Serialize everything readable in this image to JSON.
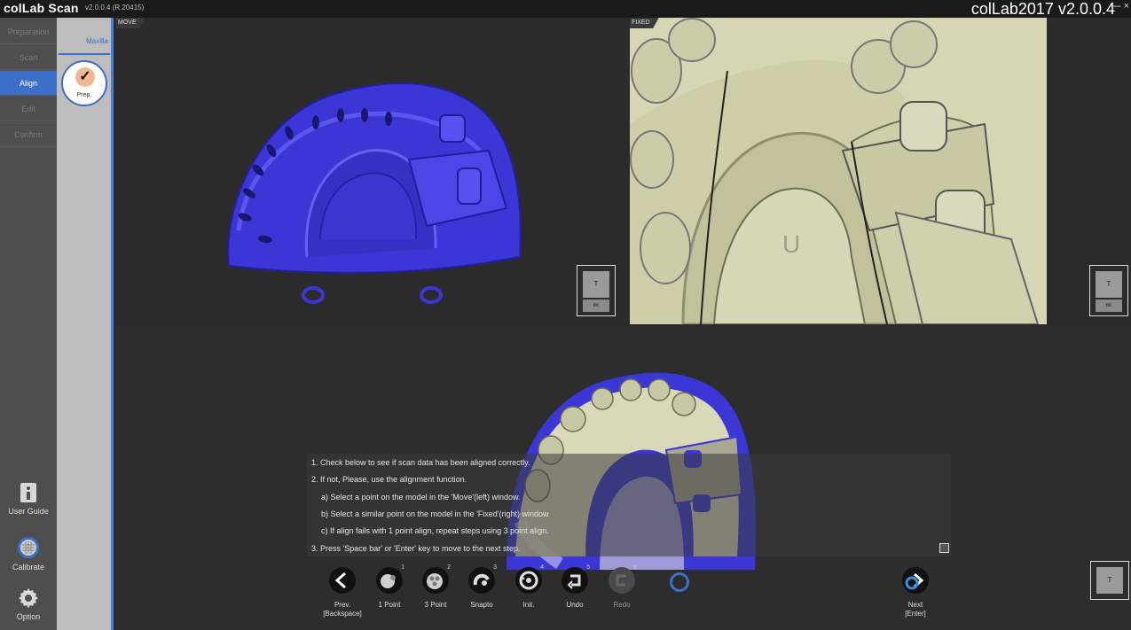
{
  "app": {
    "logo": "colLab Scan",
    "version": "v2.0.0.4 (R.20415)",
    "brand": "colLab2017 v2.0.0.4",
    "window_controls": "— ×"
  },
  "sidebar": {
    "steps": [
      {
        "label": "Preparation",
        "state": "disabled"
      },
      {
        "label": "Scan",
        "state": "disabled"
      },
      {
        "label": "Align",
        "state": "active"
      },
      {
        "label": "Edit",
        "state": "disabled"
      },
      {
        "label": "Confirm",
        "state": "disabled"
      }
    ],
    "tools": [
      {
        "label": "User Guide",
        "icon": "info-icon"
      },
      {
        "label": "Calibrate",
        "icon": "calibrate-icon"
      },
      {
        "label": "Option",
        "icon": "gear-icon"
      }
    ]
  },
  "subpanel": {
    "tab": "Maxilla",
    "step_label": "Prep.",
    "step_icon": "check-icon"
  },
  "viewports": {
    "move_label": "MOVE",
    "fixed_label": "FIXED",
    "cube_top": "T",
    "cube_back": "BK"
  },
  "instructions": [
    "1. Check below to see if scan data has been aligned correctly.",
    "2. If not, Please, use the alignment function.",
    "a) Select a point on the model in the 'Move'(left) window.",
    "b) Select a similar point on the model in the 'Fixed'(right) window",
    "c) If align fails with 1 point align, repeat steps using 3 point align.",
    "3. Press 'Space bar' or 'Enter' key to move to the next step."
  ],
  "toolbar": {
    "prev": {
      "label": "Prev.",
      "hint": "[Backspace]",
      "icon": "arrow-left-icon"
    },
    "buttons": [
      {
        "label": "1 Point",
        "num": "1",
        "icon": "one-point-icon",
        "enabled": true
      },
      {
        "label": "3 Point",
        "num": "2",
        "icon": "three-point-icon",
        "enabled": true
      },
      {
        "label": "Snapto",
        "num": "3",
        "icon": "snapto-icon",
        "enabled": true
      },
      {
        "label": "Init.",
        "num": "4",
        "icon": "init-icon",
        "enabled": true
      },
      {
        "label": "Undo",
        "num": "5",
        "icon": "undo-icon",
        "enabled": true
      },
      {
        "label": "Redo",
        "num": "6",
        "icon": "redo-icon",
        "enabled": false
      }
    ],
    "next": {
      "label": "Next",
      "hint": "[Enter]",
      "icon": "next-icon"
    }
  },
  "colors": {
    "accent": "#3c6fc9",
    "move_model": "#3b36d6",
    "fixed_model": "#d9d8b8",
    "sidebar_bg": "#4e4e4e",
    "subpanel_bg": "#bdbdbd"
  }
}
